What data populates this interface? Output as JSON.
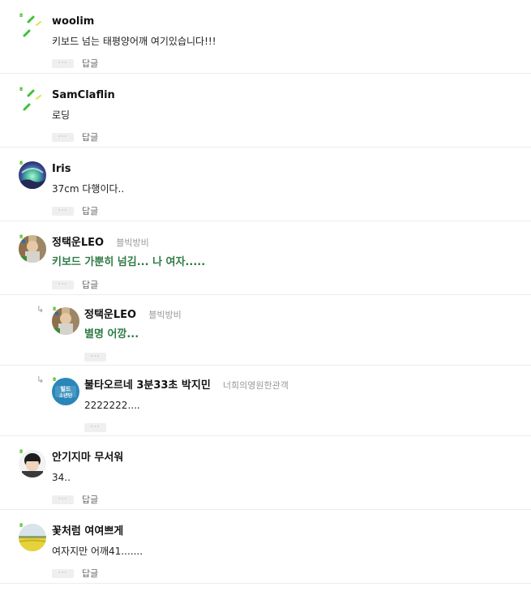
{
  "ui": {
    "more_label": "···",
    "reply_label": "답글",
    "level_badge": "8"
  },
  "comments": [
    {
      "nick": "woolim",
      "grade": "",
      "text": "키보드 넘는 태평양어깨 여기있습니다!!!"
    },
    {
      "nick": "SamClaflin",
      "grade": "",
      "text": "로딩"
    },
    {
      "nick": "Iris",
      "grade": "",
      "text": "37cm 다행이다.."
    },
    {
      "nick": "정택운LEO",
      "grade": "블빅방비",
      "text": "키보드 가뿐히 넘김... 나 여자....."
    },
    {
      "nick": "정택운LEO",
      "grade": "블빅방비",
      "text": "별명 어깡..."
    },
    {
      "nick": "불타오르네 3분33초 박지민",
      "grade": "너희의영원한관객",
      "text": "2222222...."
    },
    {
      "nick": "안기지마 무서워",
      "grade": "",
      "text": "34.."
    },
    {
      "nick": "꽃처럼 여여쁘게",
      "grade": "",
      "text": "여자지만 어깨41......."
    }
  ],
  "avatar_art": {
    "badge_text": "빌드 소년단"
  }
}
